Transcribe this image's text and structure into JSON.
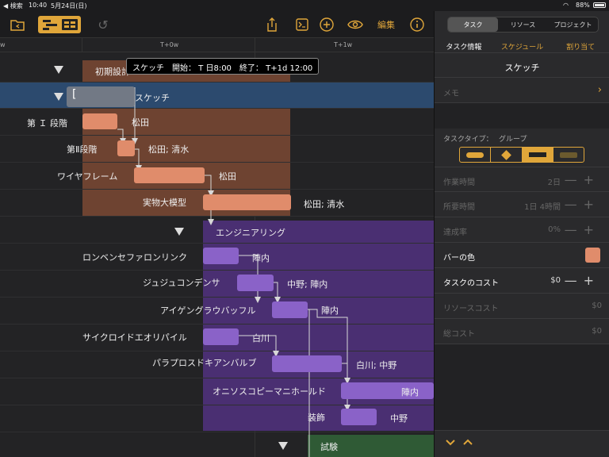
{
  "status": {
    "left": "◀ 検索",
    "time": "10:40",
    "date": "5月24日(日)",
    "battery": "88%"
  },
  "toolbar": {
    "edit_label": "編集"
  },
  "timeline": {
    "labels": [
      "w",
      "T+0w",
      "T+1w"
    ]
  },
  "tooltip": "スケッチ　開始： T 日8:00　終了： T+1d 12:00",
  "tasks": {
    "initial_design": "初期設計",
    "sketch": "スケッチ",
    "phase1": "第 Ｉ 段階",
    "phase1_res": "松田",
    "phase2": "第Ⅱ段階",
    "phase2_res": "松田; 清水",
    "wireframe": "ワイヤフレーム",
    "wireframe_res": "松田",
    "mockup": "実物大模型",
    "mockup_res": "松田; 清水",
    "engineering": "エンジニアリング",
    "t1": "ロンベンセファロンリンク",
    "t1_res": "陣内",
    "t2": "ジュジュコンデンサ",
    "t2_res": "中野; 陣内",
    "t3": "アイゲングラウバッフル",
    "t3_res": "陣内",
    "t4": "サイクロイドエオリパイル",
    "t4_res": "白川",
    "t5": "パラプロスドキアンバルブ",
    "t5_res": "白川; 中野",
    "t6": "オニソスコピーマニホールド",
    "t6_res": "陣内",
    "t7": "装飾",
    "t7_res": "中野",
    "testing": "試験"
  },
  "colors": {
    "accent": "#e0a63a",
    "design": "#6e4331",
    "design_bar": "#e08c6b",
    "eng": "#4a2f72",
    "eng_bar": "#8a62c8",
    "test": "#2f5a35",
    "selected_row": "#2c4a6e"
  },
  "inspector": {
    "seg": [
      "タスク",
      "リソース",
      "プロジェクト"
    ],
    "tabs": [
      "タスク情報",
      "スケジュール",
      "割り当て"
    ],
    "task_name": "スケッチ",
    "memo_placeholder": "メモ",
    "task_type_label": "タスクタイプ：",
    "task_type_value": "グループ",
    "work_label": "作業時間",
    "work_value": "2日",
    "duration_label": "所要時間",
    "duration_value": "1日 4時間",
    "complete_label": "達成率",
    "complete_value": "0%",
    "bar_color_label": "バーの色",
    "cost_label": "タスクのコスト",
    "cost_value": "$0",
    "resource_cost_label": "リソースコスト",
    "resource_cost_value": "$0",
    "total_cost_label": "総コスト",
    "total_cost_value": "$0"
  }
}
